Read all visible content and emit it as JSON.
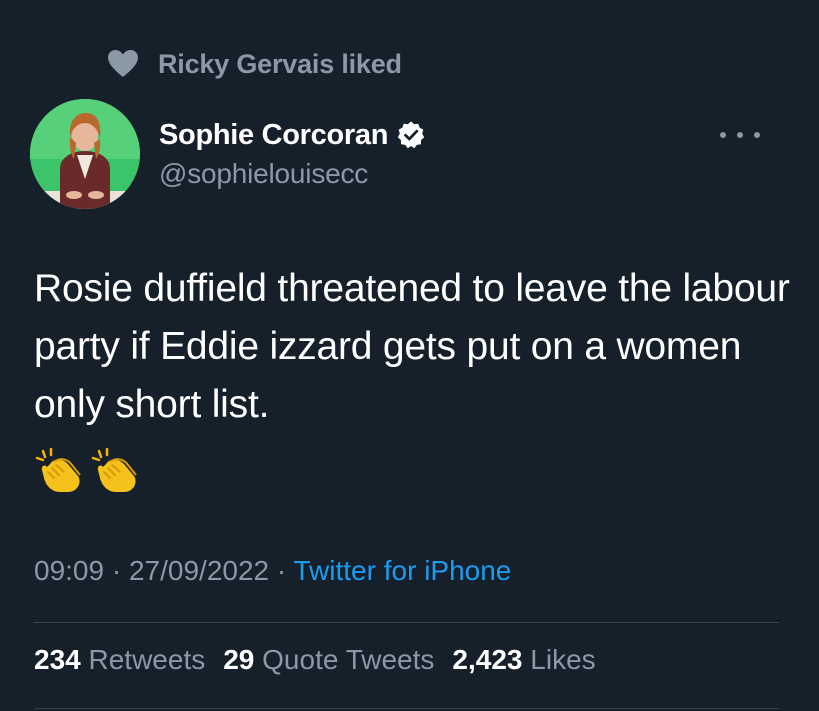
{
  "context": {
    "icon": "heart-icon",
    "text": "Ricky Gervais liked"
  },
  "author": {
    "display_name": "Sophie Corcoran",
    "handle": "@sophielouisecc",
    "verified": true
  },
  "tweet": {
    "text": "Rosie duffield threatened to leave the labour party if Eddie izzard gets put on a women only short list.",
    "emojis": [
      "clapping-hands-emoji",
      "clapping-hands-emoji"
    ]
  },
  "meta": {
    "time": "09:09",
    "separator": "·",
    "date": "27/09/2022",
    "source": "Twitter for iPhone"
  },
  "stats": {
    "retweets_count": "234",
    "retweets_label": "Retweets",
    "quotes_count": "29",
    "quotes_label": "Quote Tweets",
    "likes_count": "2,423",
    "likes_label": "Likes"
  },
  "colors": {
    "background": "#15202b",
    "secondary_text": "#8b98a5",
    "link": "#1d9bf0",
    "divider": "#38444d"
  }
}
